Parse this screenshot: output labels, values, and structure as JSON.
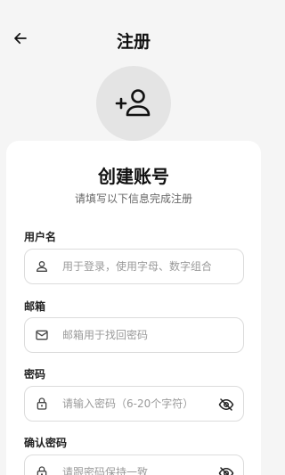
{
  "header": {
    "title": "注册"
  },
  "form": {
    "title": "创建账号",
    "subtitle": "请填写以下信息完成注册",
    "username": {
      "label": "用户名",
      "placeholder": "用于登录，使用字母、数字组合",
      "value": ""
    },
    "email": {
      "label": "邮箱",
      "placeholder": "邮箱用于找回密码",
      "value": ""
    },
    "password": {
      "label": "密码",
      "placeholder": "请输入密码（6-20个字符）",
      "value": ""
    },
    "confirm_password": {
      "label": "确认密码",
      "placeholder": "请跟密码保持一致",
      "value": ""
    }
  },
  "icons": [
    "arrow-left-icon",
    "add-person-icon",
    "person-icon",
    "mail-icon",
    "lock-icon",
    "eye-off-icon"
  ]
}
